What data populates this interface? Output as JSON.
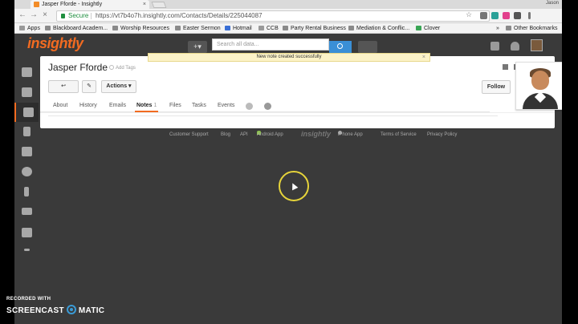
{
  "browser": {
    "tab_title": "Jasper Fforde - Insightly",
    "tab_close": "×",
    "user_name": "Jason",
    "secure_label": "Secure",
    "url": "https://vt7b4o7h.insightly.com/Contacts/Details/225044087",
    "back": "←",
    "forward": "→",
    "reload": "×",
    "star": "☆"
  },
  "bookmarks": [
    "Apps",
    "Blackboard Academ...",
    "Worship Resources",
    "Easter Sermon",
    "Hotmail",
    "CCB",
    "Party Rental Business",
    "Mediation & Conflic...",
    "Clover"
  ],
  "bookmarks_more": "»",
  "other_bookmarks": "Other Bookmarks",
  "app": {
    "logo": "insightly",
    "add_label": "+▾",
    "search_placeholder": "Search all data..."
  },
  "notification": {
    "message": "New note created successfully",
    "close": "×"
  },
  "contact": {
    "name": "Jasper Fforde",
    "add_tags": "Add Tags",
    "back_btn": "↩",
    "edit_btn": "✎",
    "actions_btn": "Actions ▾",
    "follow_btn": "Follow"
  },
  "tabs": [
    {
      "label": "About"
    },
    {
      "label": "History"
    },
    {
      "label": "Emails"
    },
    {
      "label": "Notes",
      "count": "1"
    },
    {
      "label": "Files"
    },
    {
      "label": "Tasks"
    },
    {
      "label": "Events"
    }
  ],
  "footer": {
    "support": "Customer Support",
    "blog": "Blog",
    "api": "API",
    "android": "Android App",
    "logo": "insightly",
    "iphone": "iPhone App",
    "terms": "Terms of Service",
    "privacy": "Privacy Policy"
  },
  "watermark": {
    "recorded": "RECORDED WITH",
    "brand_left": "SCREENCAST",
    "brand_right": "MATIC"
  },
  "colors": {
    "accent": "#f26b21",
    "notification_bg": "#fcf3c8",
    "search_button": "#3a8fd6"
  }
}
